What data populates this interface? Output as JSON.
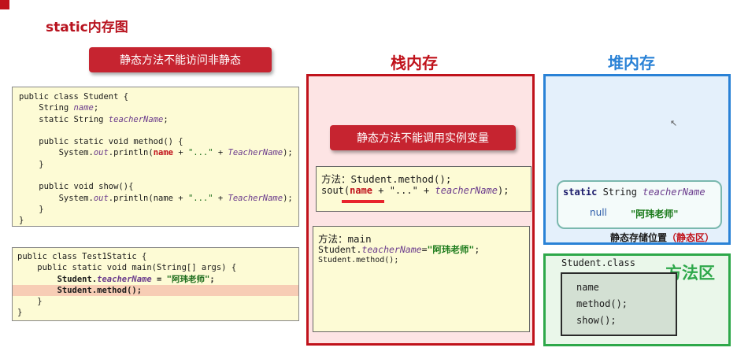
{
  "page": {
    "title": "static内存图"
  },
  "banners": {
    "left": "静态方法不能访问非静态",
    "stack": "静态方法不能调用实例变量"
  },
  "headings": {
    "stack": "栈内存",
    "heap": "堆内存",
    "method_area": "方法区"
  },
  "student_code": {
    "l1": "public class Student {",
    "l2a": "    String ",
    "l2b": "name",
    "l2c": ";",
    "l3a": "    static String ",
    "l3b": "teacherName",
    "l3c": ";",
    "l4": "",
    "l5": "    public static void method() {",
    "l6a": "        System.",
    "l6b": "out",
    "l6c": ".println(",
    "l6d": "name",
    "l6e": " + ",
    "l6f": "\"...\"",
    "l6g": " + ",
    "l6h": "TeacherName",
    "l6i": ");",
    "l7": "    }",
    "l8": "",
    "l9": "    public void show(){",
    "l10a": "        System.",
    "l10b": "out",
    "l10c": ".println(name + ",
    "l10d": "\"...\"",
    "l10e": " + ",
    "l10f": "TeacherName",
    "l10g": ");",
    "l11": "    }",
    "l12": "}"
  },
  "test_code": {
    "l1": "public class Test1Static {",
    "l2": "    public static void main(String[] args) {",
    "l3a": "        Student.",
    "l3b": "teacherName",
    "l3c": " = ",
    "l3d": "\"阿玮老师\"",
    "l3e": ";",
    "l4": "        Student.method();",
    "l5": "    }",
    "l6": "}"
  },
  "stack_frame_method": {
    "l1": "方法：Student.method();",
    "l2a": "sout(",
    "l2b": "name",
    "l2c": " + \"...\" + ",
    "l2d": "teacherName",
    "l2e": ");"
  },
  "stack_frame_main": {
    "l1": "方法：main",
    "l2a": "Student.",
    "l2b": "teacherName",
    "l2c": "=",
    "l2d": "\"阿玮老师\"",
    "l2e": ";",
    "l3": "Student.method();"
  },
  "heap": {
    "static_decl_a": "static",
    "static_decl_b": " String ",
    "static_decl_c": "teacherName",
    "value_null": "null",
    "value_str": "\"阿玮老师\"",
    "caption_a": "静态存储位置",
    "caption_b": "（静态区）"
  },
  "method_area": {
    "class_name": "Student.class",
    "members": [
      "name",
      "method();",
      "show();"
    ]
  },
  "colors": {
    "accent_red": "#c0121b",
    "heap_blue": "#2a82d6",
    "method_green": "#2ea84a"
  }
}
